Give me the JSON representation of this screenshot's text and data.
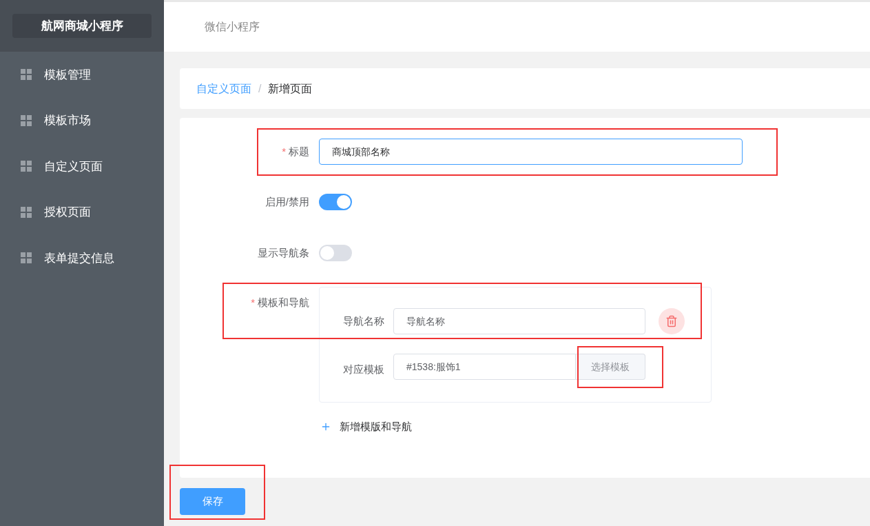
{
  "sidebar": {
    "title": "航网商城小程序",
    "items": [
      {
        "label": "模板管理"
      },
      {
        "label": "模板市场"
      },
      {
        "label": "自定义页面"
      },
      {
        "label": "授权页面"
      },
      {
        "label": "表单提交信息"
      }
    ]
  },
  "top_bar": {
    "title": "微信小程序"
  },
  "breadcrumb": {
    "items": [
      "自定义页面",
      "新增页面"
    ],
    "separator": "/"
  },
  "form": {
    "title_field": {
      "label": "标题",
      "required_mark": "*",
      "value": "商城顶部名称"
    },
    "switches": [
      {
        "label": "启用/禁用",
        "on": true
      },
      {
        "label": "显示导航条",
        "on": false
      }
    ],
    "templates": {
      "label": "模板和导航",
      "required_mark": "*",
      "entries": [
        {
          "nav_label": "导航名称",
          "nav_value": "导航名称",
          "template_label": "对应模板",
          "template_value": "#1538:服饰1",
          "choose_button": "选择模板"
        }
      ]
    },
    "add_button": "新增模版和导航"
  },
  "save_button": "保存"
}
